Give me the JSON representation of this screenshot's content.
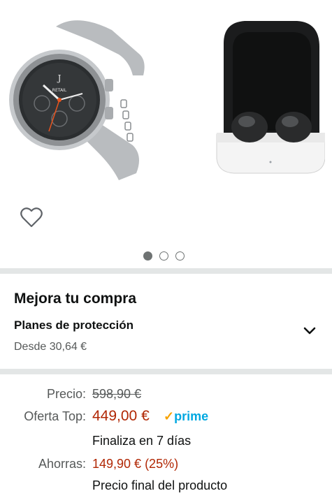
{
  "gallery": {
    "watch_face_text": "RETAIL",
    "dots": [
      "active",
      "inactive",
      "inactive"
    ]
  },
  "upgrade": {
    "title": "Mejora tu compra",
    "plan_title": "Planes de protección",
    "plan_price": "Desde 30,64 €"
  },
  "pricing": {
    "list_label": "Precio:",
    "list_price": "598,90 €",
    "deal_label": "Oferta Top:",
    "deal_price": "449,00 €",
    "prime_check": "✓",
    "prime_label": "prime",
    "deal_note": "Finaliza en 7 días",
    "savings_label": "Ahorras:",
    "savings_value": "149,90 € (25%)",
    "final_note": "Precio final del producto"
  },
  "colors": {
    "deal_red": "#b12704",
    "prime_blue": "#00a8e1",
    "prime_check": "#f7a200",
    "divider": "#e3e6e6"
  }
}
